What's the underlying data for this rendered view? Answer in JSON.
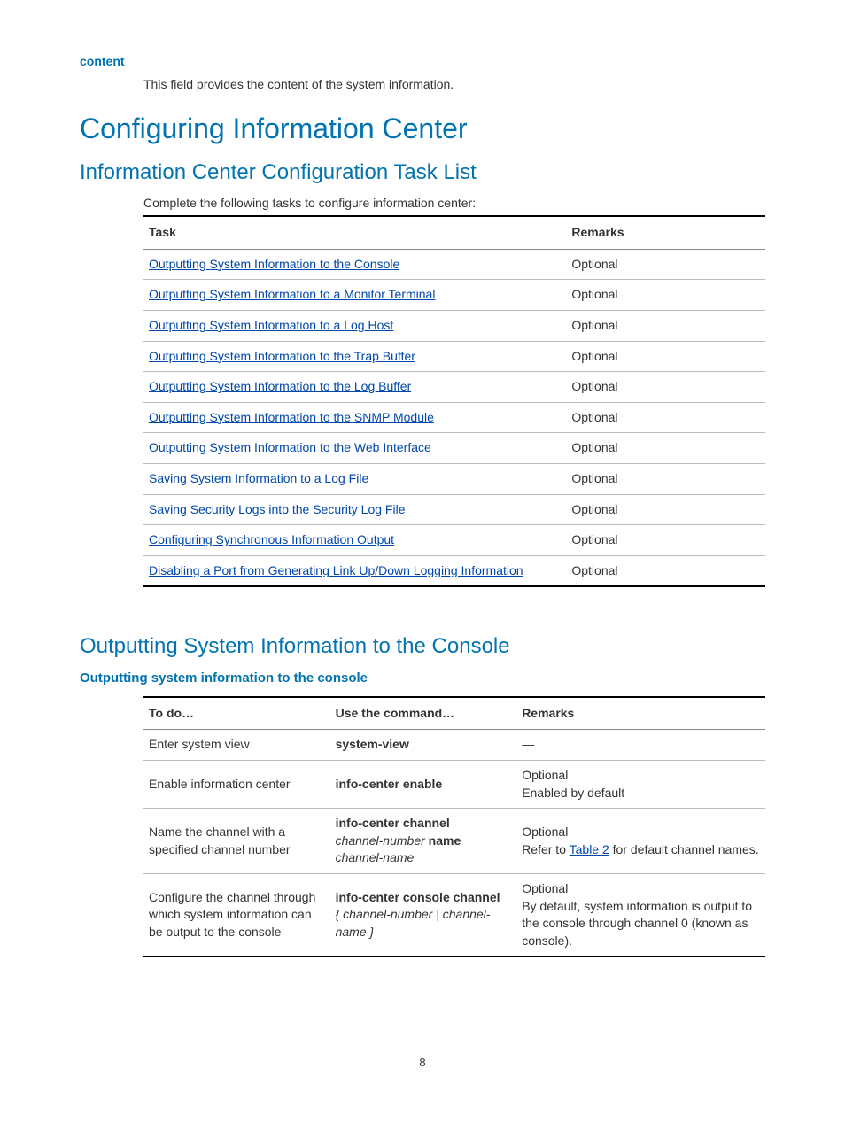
{
  "content": {
    "label": "content",
    "desc": "This field provides the content of the system information."
  },
  "h1": "Configuring Information Center",
  "section1": {
    "title": "Information Center Configuration Task List",
    "intro": "Complete the following tasks to configure information center:",
    "headers": {
      "task": "Task",
      "remarks": "Remarks"
    },
    "rows": [
      {
        "task": "Outputting System Information to the Console",
        "remarks": "Optional"
      },
      {
        "task": "Outputting System Information to a Monitor Terminal",
        "remarks": "Optional"
      },
      {
        "task": "Outputting System Information to a Log Host",
        "remarks": "Optional"
      },
      {
        "task": "Outputting System Information to the Trap Buffer",
        "remarks": "Optional"
      },
      {
        "task": "Outputting System Information to the Log Buffer",
        "remarks": "Optional"
      },
      {
        "task": "Outputting System Information to the SNMP Module",
        "remarks": "Optional"
      },
      {
        "task": "Outputting System Information to the Web Interface",
        "remarks": "Optional"
      },
      {
        "task": "Saving System Information to a Log File",
        "remarks": "Optional"
      },
      {
        "task": "Saving Security Logs into the Security Log File",
        "remarks": "Optional"
      },
      {
        "task": "Configuring Synchronous Information Output",
        "remarks": "Optional"
      },
      {
        "task": "Disabling a Port from Generating Link Up/Down Logging Information",
        "remarks": "Optional"
      }
    ]
  },
  "section2": {
    "title": "Outputting System Information to the Console",
    "subtitle": "Outputting system information to the console",
    "headers": {
      "todo": "To do…",
      "cmd": "Use the command…",
      "remarks": "Remarks"
    },
    "rows": [
      {
        "todo": "Enter system view",
        "cmd_bold": "system-view",
        "cmd_italic1": "",
        "cmd_bold2": "",
        "cmd_italic2": "",
        "cmd_tail": "",
        "remarks_line1": "—",
        "remarks_line2": "",
        "remarks_pre": "",
        "remarks_link": "",
        "remarks_post": ""
      },
      {
        "todo": "Enable information center",
        "cmd_bold": "info-center enable",
        "cmd_italic1": "",
        "cmd_bold2": "",
        "cmd_italic2": "",
        "cmd_tail": "",
        "remarks_line1": "Optional",
        "remarks_line2": "Enabled by default",
        "remarks_pre": "",
        "remarks_link": "",
        "remarks_post": ""
      },
      {
        "todo": "Name the channel with a specified channel number",
        "cmd_bold": "info-center channel",
        "cmd_italic1": "channel-number",
        "cmd_bold2": "name",
        "cmd_italic2": "channel-name",
        "cmd_tail": "",
        "remarks_line1": "Optional",
        "remarks_line2": "",
        "remarks_pre": "Refer to ",
        "remarks_link": "Table 2",
        "remarks_post": " for default channel names."
      },
      {
        "todo": "Configure the channel through which system information can be output to the console",
        "cmd_bold": "info-center console channel",
        "cmd_italic1": "",
        "cmd_bold2": "",
        "cmd_italic2": "",
        "cmd_tail": "{ channel-number | channel-name }",
        "remarks_line1": "Optional",
        "remarks_line2": "By default, system information is output to the console through channel 0 (known as console).",
        "remarks_pre": "",
        "remarks_link": "",
        "remarks_post": ""
      }
    ]
  },
  "page_number": "8"
}
